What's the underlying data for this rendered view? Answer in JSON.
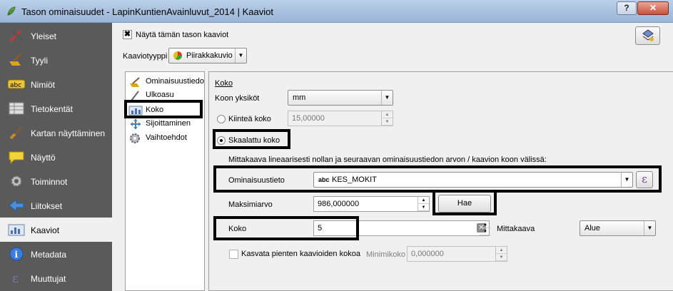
{
  "window": {
    "title": "Tason ominaisuudet - LapinKuntienAvainluvut_2014 | Kaaviot",
    "help_label": "?",
    "close_label": "✕"
  },
  "sidebar": {
    "items": [
      {
        "label": "Yleiset",
        "icon": "tools-icon"
      },
      {
        "label": "Tyyli",
        "icon": "paint-icon"
      },
      {
        "label": "Nimiöt",
        "icon": "abc-icon"
      },
      {
        "label": "Tietokentät",
        "icon": "table-icon"
      },
      {
        "label": "Kartan näyttäminen",
        "icon": "brush-icon"
      },
      {
        "label": "Näyttö",
        "icon": "speech-bubble-icon"
      },
      {
        "label": "Toiminnot",
        "icon": "gear-icon"
      },
      {
        "label": "Liitokset",
        "icon": "join-arrow-icon"
      },
      {
        "label": "Kaaviot",
        "icon": "chart-icon"
      },
      {
        "label": "Metadata",
        "icon": "info-icon"
      },
      {
        "label": "Muuttujat",
        "icon": "epsilon-icon"
      }
    ],
    "active": "Kaaviot"
  },
  "content": {
    "show_diagrams_label": "Näytä tämän tason kaaviot",
    "show_diagrams_checked": true,
    "diagram_type_label": "Kaaviotyyppi",
    "diagram_type_value": "Piirakkakuvio",
    "tree": [
      {
        "label": "Ominaisuustiedot",
        "icon": "attributes-icon"
      },
      {
        "label": "Ulkoasu",
        "icon": "pen-icon"
      },
      {
        "label": "Koko",
        "icon": "size-icon"
      },
      {
        "label": "Sijoittaminen",
        "icon": "placement-icon"
      },
      {
        "label": "Vaihtoehdot",
        "icon": "options-icon"
      }
    ],
    "size": {
      "group_title": "Koko",
      "units_label": "Koon yksiköt",
      "units_value": "mm",
      "fixed_label": "Kiinteä koko",
      "fixed_value": "15,00000",
      "scaled_label": "Skaalattu koko",
      "scaling_desc": "Mittakaava lineaarisesti nollan ja seuraavan ominaisuustiedon arvon / kaavion koon välissä:",
      "attribute_label": "Ominaisuustieto",
      "attribute_prefix": "abc",
      "attribute_value": "KES_MOKIT",
      "epsilon": "ε",
      "max_label": "Maksimiarvo",
      "max_value": "986,000000",
      "fetch_label": "Hae",
      "size_label": "Koko",
      "size_value": "5",
      "scale_label": "Mittakaava",
      "scale_value": "Alue",
      "increase_small_label": "Kasvata pienten kaavioiden kokoa",
      "min_size_label": "Minimikoko",
      "min_size_value": "0,000000"
    }
  }
}
